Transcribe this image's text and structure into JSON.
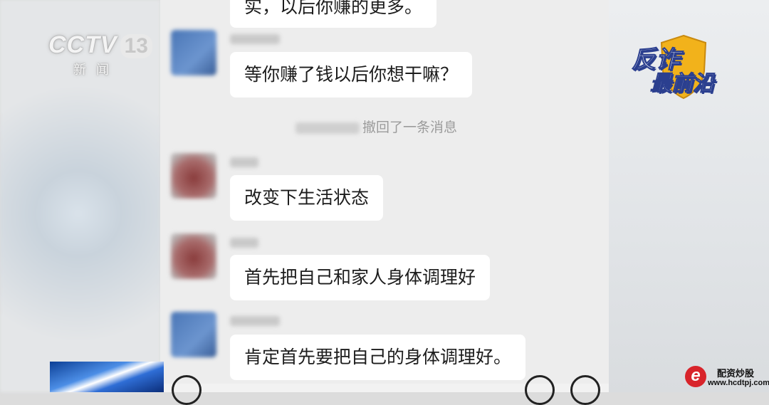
{
  "channel_logo": {
    "name": "CCTV",
    "channel": "13",
    "subtitle": "新闻"
  },
  "program_badge": {
    "line1": "反诈",
    "line2": "最前沿"
  },
  "chat": {
    "messages": [
      {
        "text": "实，以后你赚的更多。",
        "avatar": "blue"
      },
      {
        "text": "等你赚了钱以后你想干嘛？",
        "avatar": "blue"
      },
      {
        "text": "改变下生活状态",
        "avatar": "red"
      },
      {
        "text": "首先把自己和家人身体调理好",
        "avatar": "red"
      },
      {
        "text": "肯定首先要把自己的身体调理好。",
        "avatar": "blue"
      }
    ],
    "recall_notice": "撤回了一条消息"
  },
  "watermark": {
    "title": "配资炒股",
    "url": "www.hcdtpj.com",
    "logo_letter": "e"
  },
  "colors": {
    "chat_bg": "#ededed",
    "bubble_bg": "#ffffff",
    "text": "#1c1c1c",
    "watermark_red": "#d8242b"
  }
}
